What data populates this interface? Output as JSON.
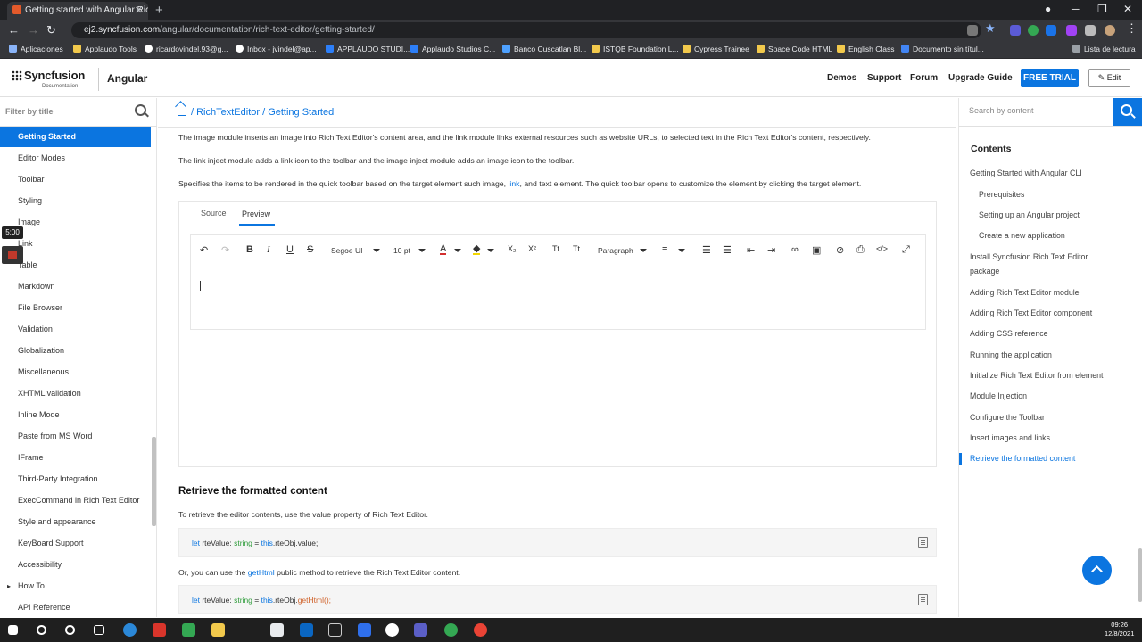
{
  "browser": {
    "tab_title": "Getting started with Angular Rich",
    "url_host": "ej2.syncfusion.com",
    "url_path": "/angular/documentation/rich-text-editor/getting-started/",
    "bookmarks": [
      "Aplicaciones",
      "Applaudo Tools",
      "ricardovindel.93@g...",
      "Inbox - jvindel@ap...",
      "APPLAUDO STUDI...",
      "Applaudo Studios C...",
      "Banco Cuscatlan Bl...",
      "ISTQB Foundation L...",
      "Cypress Trainee",
      "Space Code HTML",
      "English Class",
      "Documento sin títul...",
      "Lista de lectura"
    ]
  },
  "header": {
    "logo_name": "Syncfusion",
    "logo_sub": "Documentation",
    "product": "Angular",
    "nav": [
      "Demos",
      "Support",
      "Forum",
      "Upgrade Guide"
    ],
    "free_trial": "FREE TRIAL",
    "edit": "Edit"
  },
  "sidebar": {
    "filter_placeholder": "Filter by title",
    "items": [
      "Getting Started",
      "Editor Modes",
      "Toolbar",
      "Styling",
      "Image",
      "Link",
      "Table",
      "Markdown",
      "File Browser",
      "Validation",
      "Globalization",
      "Miscellaneous",
      "XHTML validation",
      "Inline Mode",
      "Paste from MS Word",
      "IFrame",
      "Third-Party Integration",
      "ExecCommand in Rich Text Editor",
      "Style and appearance",
      "KeyBoard Support",
      "Accessibility",
      "How To",
      "API Reference"
    ],
    "recorder_time": "5:00"
  },
  "breadcrumb": {
    "text": "/ RichTextEditor / Getting Started"
  },
  "content": {
    "p1": "The image module inserts an image into Rich Text Editor's content area, and the link module links external resources such as website URLs, to selected text in the Rich Text Editor's content, respectively.",
    "p2": "The link inject module adds a link icon to the toolbar and the image inject module adds an image icon to the toolbar.",
    "p3_a": "Specifies the items to be rendered in the quick toolbar based on the target element such image, ",
    "p3_link": "link",
    "p3_b": ", and text element. The quick toolbar opens to customize the element by clicking the target element.",
    "tab_source": "Source",
    "tab_preview": "Preview",
    "toolbar": {
      "font_name": "Segoe UI",
      "font_size": "10 pt",
      "format": "Paragraph"
    },
    "h2": "Retrieve the formatted content",
    "p4": "To retrieve the editor contents, use the value property of Rich Text Editor.",
    "code1": {
      "kw": "let",
      "var": " rteValue",
      "colon": ": ",
      "type": "string",
      "eq": " = ",
      "this": "this",
      "rest": ".rteObj.value;"
    },
    "p5_a": "Or, you can use the ",
    "p5_link": "getHtml",
    "p5_b": " public method to retrieve the Rich Text Editor content.",
    "code2": {
      "kw": "let",
      "var": " rteValue",
      "colon": ": ",
      "type": "string",
      "eq": " = ",
      "this": "this",
      "rest": ".rteObj.",
      "fn": "getHtml();"
    }
  },
  "right": {
    "search_placeholder": "Search by content",
    "contents_title": "Contents",
    "toc": [
      "Getting Started with Angular CLI",
      "Prerequisites",
      "Setting up an Angular project",
      "Create a new application",
      "Install Syncfusion Rich Text Editor",
      "package",
      "Adding Rich Text Editor module",
      "Adding Rich Text Editor component",
      "Adding CSS reference",
      "Running the application",
      "Initialize Rich Text Editor from element",
      "Module Injection",
      "Configure the Toolbar",
      "Insert images and links",
      "Retrieve the formatted content"
    ]
  },
  "taskbar": {
    "time": "09:26",
    "date": "12/8/2021"
  },
  "colors": {
    "accent": "#0b75e0",
    "chrome_dark": "#202124",
    "chrome_mid": "#35363a"
  }
}
